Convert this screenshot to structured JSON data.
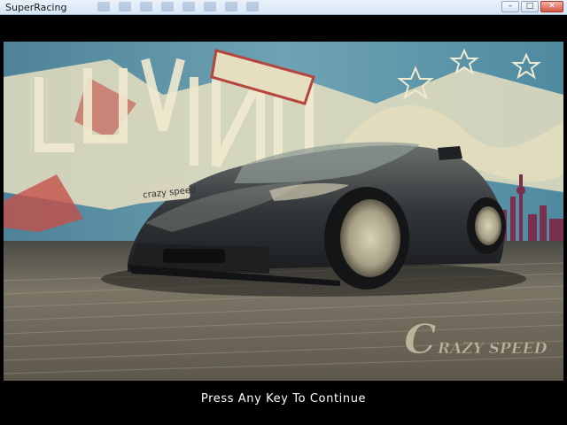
{
  "window": {
    "title": "SuperRacing",
    "min_glyph": "–",
    "max_glyph": "□",
    "close_glyph": "✕"
  },
  "splash": {
    "logo_initial": "C",
    "logo_rest": "RAZY SPEED",
    "plate_text": "crazy speed",
    "prompt": "Press Any Key To Continue"
  },
  "colors": {
    "sky_teal": "#5f95a8",
    "mural_cream": "#e6dfbf",
    "mural_red": "#c4504a",
    "car_body": "#2f3337",
    "road": "#6e6a5c",
    "letterbox": "#000000"
  },
  "icons": [
    "minimize-icon",
    "maximize-icon",
    "close-icon"
  ]
}
